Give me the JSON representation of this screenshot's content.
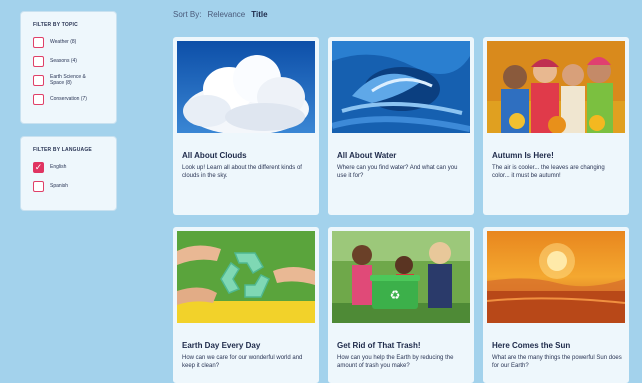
{
  "filters": {
    "topic": {
      "title": "FILTER BY TOPIC",
      "options": [
        {
          "label": "Weather (8)",
          "checked": false
        },
        {
          "label": "Seasons (4)",
          "checked": false
        },
        {
          "label": "Earth Science &\nSpace (8)",
          "checked": false
        },
        {
          "label": "Conservation (7)",
          "checked": false
        }
      ]
    },
    "language": {
      "title": "FILTER BY LANGUAGE",
      "options": [
        {
          "label": "English",
          "checked": true
        },
        {
          "label": "Spanish",
          "checked": false
        }
      ]
    }
  },
  "sort": {
    "label": "Sort By:",
    "options": [
      "Relevance",
      "Title"
    ],
    "active": "Title"
  },
  "cards": [
    {
      "title": "All About Clouds",
      "description": "Look up! Learn all about the different kinds of clouds in the sky.",
      "image": "cumulus-clouds-photo"
    },
    {
      "title": "All About Water",
      "description": "Where can you find water? And what can you use it for?",
      "image": "ocean-wave-photo"
    },
    {
      "title": "Autumn Is Here!",
      "description": "The air is cooler... the leaves are changing color... it must be autumn!",
      "image": "kids-in-autumn-leaves-photo"
    },
    {
      "title": "Earth Day Every Day",
      "description": "How can we care for our wonderful world and keep it clean?",
      "image": "hands-recycle-symbol-photo"
    },
    {
      "title": "Get Rid of That Trash!",
      "description": "How can you help the Earth by reducing the amount of trash you make?",
      "image": "kids-with-recycling-bin-photo"
    },
    {
      "title": "Here Comes the Sun",
      "description": "What are the many things the powerful Sun does for our Earth?",
      "image": "sunset-sky-photo"
    }
  ],
  "colors": {
    "background": "#a3d2ec",
    "panel": "#eef7fc",
    "checkbox_accent": "#e03461",
    "text": "#1e2a4a"
  }
}
